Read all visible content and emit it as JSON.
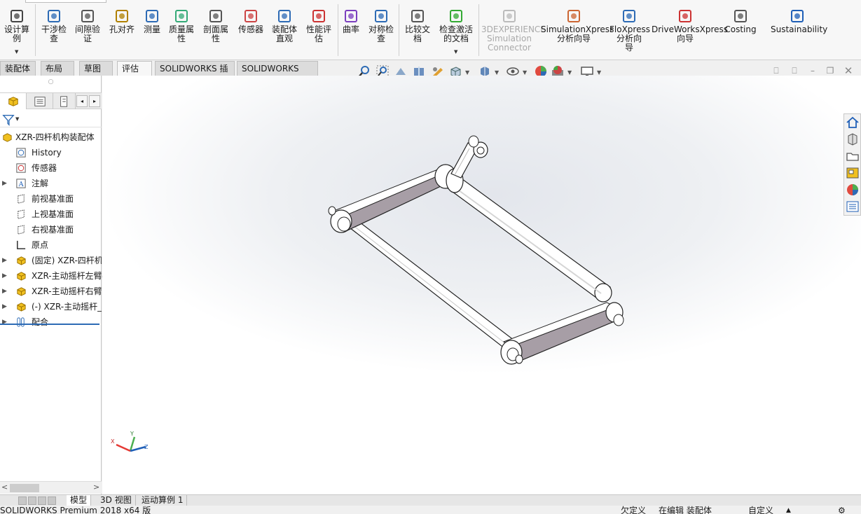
{
  "ribbon": {
    "buttons": [
      {
        "label": "设计算\n例",
        "icon": "design-study-icon"
      },
      {
        "label": "干涉检\n查",
        "icon": "interference-icon"
      },
      {
        "label": "间隙验\n证",
        "icon": "clearance-icon"
      },
      {
        "label": "孔对齐",
        "icon": "hole-align-icon"
      },
      {
        "label": "测量",
        "icon": "measure-icon"
      },
      {
        "label": "质量属\n性",
        "icon": "mass-props-icon"
      },
      {
        "label": "剖面属\n性",
        "icon": "section-props-icon"
      },
      {
        "label": "传感器",
        "icon": "sensor-icon"
      },
      {
        "label": "装配体\n直观",
        "icon": "assembly-visual-icon"
      },
      {
        "label": "性能评\n估",
        "icon": "performance-icon"
      },
      {
        "label": "曲率",
        "icon": "curvature-icon"
      },
      {
        "label": "对称检\n查",
        "icon": "symmetry-icon"
      },
      {
        "label": "比较文\n档",
        "icon": "compare-icon"
      },
      {
        "label": "检查激活\n的文档",
        "icon": "check-active-icon"
      },
      {
        "label": "3DEXPERIENCE\nSimulation\nConnector",
        "icon": "3dexperience-icon",
        "disabled": true
      },
      {
        "label": "SimulationXpress\n分析向导",
        "icon": "simxpress-icon"
      },
      {
        "label": "FloXpress\n分析向\n导",
        "icon": "floxpress-icon"
      },
      {
        "label": "DriveWorksXpress\n向导",
        "icon": "driveworks-icon"
      },
      {
        "label": "Costing",
        "icon": "costing-icon"
      },
      {
        "label": "Sustainability",
        "icon": "sustainability-icon"
      }
    ]
  },
  "tabs": [
    "装配体",
    "布局",
    "草图",
    "评估",
    "SOLIDWORKS 插件",
    "SOLIDWORKS MBD"
  ],
  "active_tab": "评估",
  "tree": {
    "root": "XZR-四杆机构装配体",
    "items": [
      {
        "label": "History",
        "icon": "history-icon",
        "expand": false
      },
      {
        "label": "传感器",
        "icon": "sensor-folder-icon",
        "expand": false
      },
      {
        "label": "注解",
        "icon": "annotation-icon",
        "expand": true
      },
      {
        "label": "前视基准面",
        "icon": "plane-icon",
        "expand": false
      },
      {
        "label": "上视基准面",
        "icon": "plane-icon",
        "expand": false
      },
      {
        "label": "右视基准面",
        "icon": "plane-icon",
        "expand": false
      },
      {
        "label": "原点",
        "icon": "origin-icon",
        "expand": false
      },
      {
        "label": "(固定) XZR-四杆机",
        "icon": "part-icon",
        "expand": true
      },
      {
        "label": "XZR-主动摇杆左臂",
        "icon": "part-icon",
        "expand": true
      },
      {
        "label": "XZR-主动摇杆右臂",
        "icon": "part-icon",
        "expand": true
      },
      {
        "label": "(-) XZR-主动摇杆_",
        "icon": "part-icon",
        "expand": true
      },
      {
        "label": "配合",
        "icon": "mates-icon",
        "expand": true
      }
    ]
  },
  "bottom_tabs": [
    "模型",
    "3D 视图",
    "运动算例 1"
  ],
  "status": {
    "left": "SOLIDWORKS Premium 2018 x64 版",
    "undefined": "欠定义",
    "editing": "在编辑 装配体",
    "custom": "自定义"
  },
  "triad": {
    "x": "X",
    "y": "Y",
    "z": "Z"
  },
  "colors": {
    "link_face": "#a79ea6",
    "accent_blue": "#1f5fb7"
  }
}
